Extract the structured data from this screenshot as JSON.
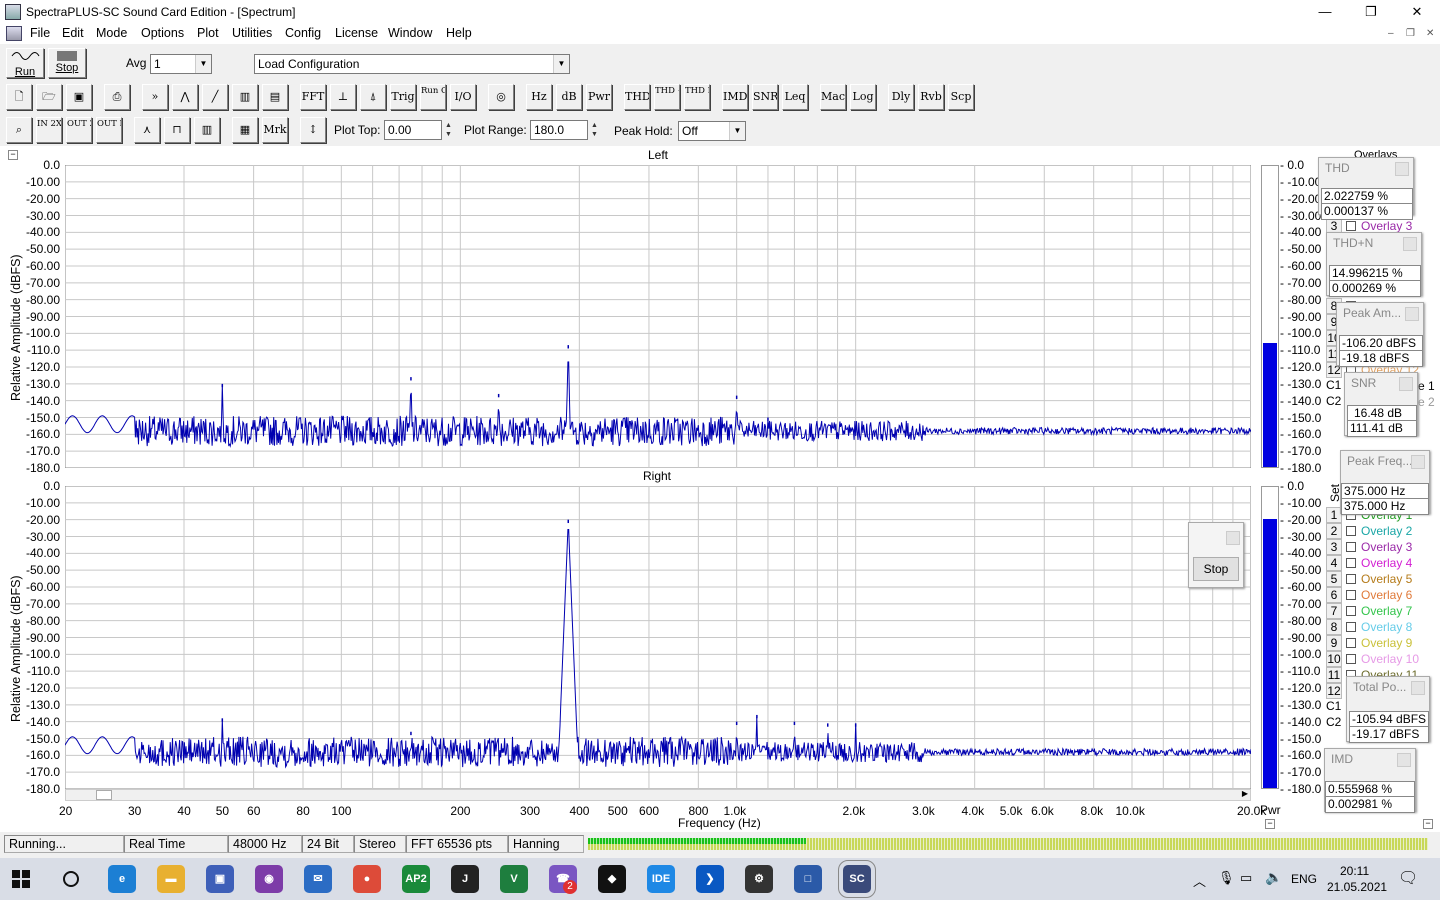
{
  "window": {
    "title": "SpectraPLUS-SC Sound Card Edition - [Spectrum]",
    "minimize": "—",
    "maximize": "❐",
    "close": "✕"
  },
  "menu": [
    "File",
    "Edit",
    "Mode",
    "Options",
    "Plot",
    "Utilities",
    "Config",
    "License",
    "Window",
    "Help"
  ],
  "mdi": {
    "min": "–",
    "restore": "❐",
    "close": "✕"
  },
  "toolbar1": {
    "run": "Run",
    "stop": "Stop",
    "avg_label": "Avg",
    "avg_value": "1",
    "config_value": "Load Configuration"
  },
  "toolbar2": [
    "FFT",
    "Trig",
    "Run Ctrl",
    "I/O",
    "Hz",
    "dB",
    "Pwr",
    "THD",
    "THD +N",
    "THD Freq",
    "IMD",
    "SNR",
    "Leq",
    "Mac",
    "Log",
    "Dly",
    "Rvb",
    "Scp"
  ],
  "toolbar3": {
    "zin": "IN 2X",
    "zout": "OUT 2X",
    "zfull": "OUT FULL",
    "mrk": "Mrk",
    "plot_top_label": "Plot Top:",
    "plot_top_value": "0.00",
    "plot_range_label": "Plot Range:",
    "plot_range_value": "180.0",
    "peak_hold_label": "Peak Hold:",
    "peak_hold_value": "Off"
  },
  "plots": {
    "left_title": "Left",
    "right_title": "Right",
    "ylabel": "Relative Amplitude (dBFS)",
    "xlabel": "Frequency (Hz)",
    "yticks": [
      "0.0",
      "-10.00",
      "-20.00",
      "-30.00",
      "-40.00",
      "-50.00",
      "-60.00",
      "-70.00",
      "-80.00",
      "-90.00",
      "-100.0",
      "-110.0",
      "-120.0",
      "-130.0",
      "-140.0",
      "-150.0",
      "-160.0",
      "-170.0",
      "-180.0"
    ],
    "xticks": [
      {
        "label": "20",
        "f": 20
      },
      {
        "label": "30",
        "f": 30
      },
      {
        "label": "40",
        "f": 40
      },
      {
        "label": "50",
        "f": 50
      },
      {
        "label": "60",
        "f": 60
      },
      {
        "label": "80",
        "f": 80
      },
      {
        "label": "100",
        "f": 100
      },
      {
        "label": "200",
        "f": 200
      },
      {
        "label": "300",
        "f": 300
      },
      {
        "label": "400",
        "f": 400
      },
      {
        "label": "500",
        "f": 500
      },
      {
        "label": "600",
        "f": 600
      },
      {
        "label": "800",
        "f": 800
      },
      {
        "label": "1.0k",
        "f": 1000
      },
      {
        "label": "2.0k",
        "f": 2000
      },
      {
        "label": "3.0k",
        "f": 3000
      },
      {
        "label": "4.0k",
        "f": 4000
      },
      {
        "label": "5.0k",
        "f": 5000
      },
      {
        "label": "6.0k",
        "f": 6000
      },
      {
        "label": "8.0k",
        "f": 8000
      },
      {
        "label": "10.0k",
        "f": 10000
      },
      {
        "label": "20.0k",
        "f": 20000
      }
    ],
    "meter_label": "Pwr",
    "meter_ticks": [
      "0.0",
      "-10.00",
      "-20.00",
      "-30.00",
      "-40.00",
      "-50.00",
      "-60.00",
      "-70.00",
      "-80.00",
      "-90.00",
      "-100.0",
      "-110.0",
      "-120.0",
      "-130.0",
      "-140.0",
      "-150.0",
      "-160.0",
      "-170.0",
      "-180.0"
    ],
    "left_meter_level_db": -106,
    "right_meter_level_db": -19
  },
  "chart_data": [
    {
      "type": "line",
      "title": "Left",
      "xlabel": "Frequency (Hz)",
      "ylabel": "Relative Amplitude (dBFS)",
      "xscale": "log",
      "xlim": [
        20,
        20000
      ],
      "ylim": [
        -180,
        0
      ],
      "grid": true,
      "noise_floor_db": -158,
      "peaks": [
        {
          "x": 50,
          "y": -130
        },
        {
          "x": 150,
          "y": -126
        },
        {
          "x": 250,
          "y": -136
        },
        {
          "x": 375,
          "y": -107
        },
        {
          "x": 1000,
          "y": -137
        },
        {
          "x": 1200,
          "y": -150
        }
      ]
    },
    {
      "type": "line",
      "title": "Right",
      "xlabel": "Frequency (Hz)",
      "ylabel": "Relative Amplitude (dBFS)",
      "xscale": "log",
      "xlim": [
        20,
        20000
      ],
      "ylim": [
        -180,
        0
      ],
      "grid": true,
      "noise_floor_db": -158,
      "peaks": [
        {
          "x": 50,
          "y": -138
        },
        {
          "x": 150,
          "y": -146
        },
        {
          "x": 375,
          "y": -20
        },
        {
          "x": 1000,
          "y": -140
        },
        {
          "x": 1125,
          "y": -136
        },
        {
          "x": 1400,
          "y": -140
        },
        {
          "x": 1700,
          "y": -141
        },
        {
          "x": 2000,
          "y": -141
        }
      ]
    }
  ],
  "panels": {
    "overlays_title": "Overlays",
    "thd": {
      "title": "THD",
      "v1": "2.022759 %",
      "v2": "0.000137 %"
    },
    "thdn": {
      "title": "THD+N",
      "v1": "14.996215 %",
      "v2": "0.000269 %"
    },
    "peak_amp": {
      "title": "Peak Am...",
      "v1": "-106.20 dBFS",
      "v2": "-19.18 dBFS"
    },
    "snr": {
      "title": "SNR",
      "v1": "16.48 dB",
      "v2": "111.41 dB"
    },
    "peak_freq": {
      "title": "Peak Freq...",
      "v1": "375.000 Hz",
      "v2": "375.000 Hz"
    },
    "total_pow": {
      "title": "Total Po...",
      "v1": "-105.94 dBFS",
      "v2": "-19.17 dBFS"
    },
    "imd": {
      "title": "IMD",
      "v1": "0.555968 %",
      "v2": "0.002981 %"
    },
    "stop_button": "Stop",
    "set_label": "Set",
    "c1": "C1",
    "c2": "C2",
    "trace1_frag": "e 1",
    "trace2_frag": "e 2",
    "overlays_top": [
      {
        "n": "3",
        "label": "Overlay 3",
        "color": "#9a2aa8"
      },
      {
        "n": "8",
        "label": "",
        "color": "#000"
      },
      {
        "n": "9",
        "label": "",
        "color": "#000"
      },
      {
        "n": "10",
        "label": "",
        "color": "#000"
      },
      {
        "n": "11",
        "label": "",
        "color": "#000"
      },
      {
        "n": "12",
        "label": "Overlay 12",
        "color": "#e0a060"
      }
    ],
    "overlays": [
      {
        "n": "1",
        "label": "Overlay 1",
        "color": "#1f9b1f"
      },
      {
        "n": "2",
        "label": "Overlay 2",
        "color": "#1aa6a6"
      },
      {
        "n": "3",
        "label": "Overlay 3",
        "color": "#9a2aa8"
      },
      {
        "n": "4",
        "label": "Overlay 4",
        "color": "#d21fd2"
      },
      {
        "n": "5",
        "label": "Overlay 5",
        "color": "#b57b1a"
      },
      {
        "n": "6",
        "label": "Overlay 6",
        "color": "#e07a3a"
      },
      {
        "n": "7",
        "label": "Overlay 7",
        "color": "#33c44b"
      },
      {
        "n": "8",
        "label": "Overlay 8",
        "color": "#66cce8"
      },
      {
        "n": "9",
        "label": "Overlay 9",
        "color": "#c9c13a"
      },
      {
        "n": "10",
        "label": "Overlay 10",
        "color": "#e69ae6"
      },
      {
        "n": "11",
        "label": "Overlay 11",
        "color": "#6b6b2a"
      },
      {
        "n": "12",
        "label": "",
        "color": "#000"
      }
    ]
  },
  "status": {
    "state": "Running...",
    "mode": "Real Time",
    "rate": "48000 Hz",
    "bits": "24 Bit",
    "channels": "Stereo",
    "fft": "FFT 65536 pts",
    "window": "Hanning",
    "input_level_fraction": 0.26
  },
  "taskbar": {
    "time": "20:11",
    "date": "21.05.2021",
    "lang": "ENG",
    "apps": [
      {
        "name": "edge",
        "label": "e",
        "color": "#1c7fd4"
      },
      {
        "name": "explorer",
        "label": "▬",
        "color": "#e8b030"
      },
      {
        "name": "save",
        "label": "▣",
        "color": "#3e5fb8"
      },
      {
        "name": "tor",
        "label": "◉",
        "color": "#7d3ca8"
      },
      {
        "name": "mail",
        "label": "✉",
        "color": "#2b6cc4"
      },
      {
        "name": "chrome",
        "label": "●",
        "color": "#dd4b39"
      },
      {
        "name": "ap2",
        "label": "AP2",
        "color": "#1a8a3a"
      },
      {
        "name": "jetbrains",
        "label": "J",
        "color": "#222"
      },
      {
        "name": "v",
        "label": "V",
        "color": "#1e7e3e"
      },
      {
        "name": "viber",
        "label": "☎",
        "color": "#7a56c2"
      },
      {
        "name": "ss",
        "label": "◆",
        "color": "#111"
      },
      {
        "name": "ide",
        "label": "IDE",
        "color": "#1e88e5"
      },
      {
        "name": "arrow",
        "label": "❯",
        "color": "#0a58c2"
      },
      {
        "name": "settings",
        "label": "⚙",
        "color": "#333"
      },
      {
        "name": "window",
        "label": "□",
        "color": "#2b5aa8"
      },
      {
        "name": "spectraplus",
        "label": "SC",
        "color": "#3a4a7a"
      }
    ],
    "viber_badge": "2"
  }
}
